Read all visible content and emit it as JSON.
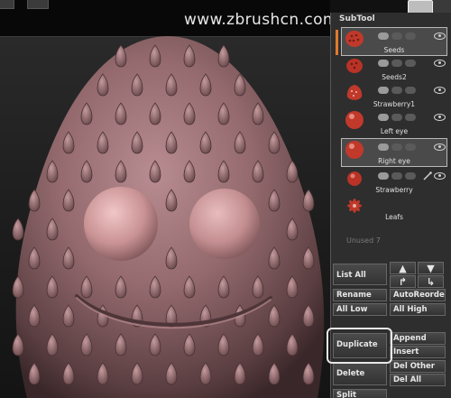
{
  "watermark": "www.zbrushcn.com",
  "panel": {
    "title": "SubTool",
    "unused_label": "Unused 7"
  },
  "subtools": [
    {
      "name": "Seeds",
      "icon": "seeds-icon",
      "selected": true
    },
    {
      "name": "Seeds2",
      "icon": "seeds-icon",
      "selected": false
    },
    {
      "name": "Strawberry1",
      "icon": "strawberry-icon",
      "selected": false
    },
    {
      "name": "Left eye",
      "icon": "eye-sphere-icon",
      "selected": false
    },
    {
      "name": "Right eye",
      "icon": "eye-sphere-icon",
      "selected": true
    },
    {
      "name": "Strawberry",
      "icon": "sphere-icon",
      "selected": false
    },
    {
      "name": "Leafs",
      "icon": "leaf-icon",
      "selected": false
    }
  ],
  "buttons": {
    "list_all": "List All",
    "rename": "Rename",
    "auto_reorder": "AutoReorder",
    "all_low": "All Low",
    "all_high": "All High",
    "duplicate": "Duplicate",
    "append": "Append",
    "insert": "Insert",
    "delete": "Delete",
    "del_other": "Del Other",
    "del_all": "Del All",
    "split": "Split"
  },
  "colors": {
    "panel_bg": "#2e2e2e",
    "accent_orange": "#e07a2a",
    "model_clay": "#9a6f73",
    "eye_sphere": "#c98f92",
    "thumb_red": "#c0392b"
  }
}
